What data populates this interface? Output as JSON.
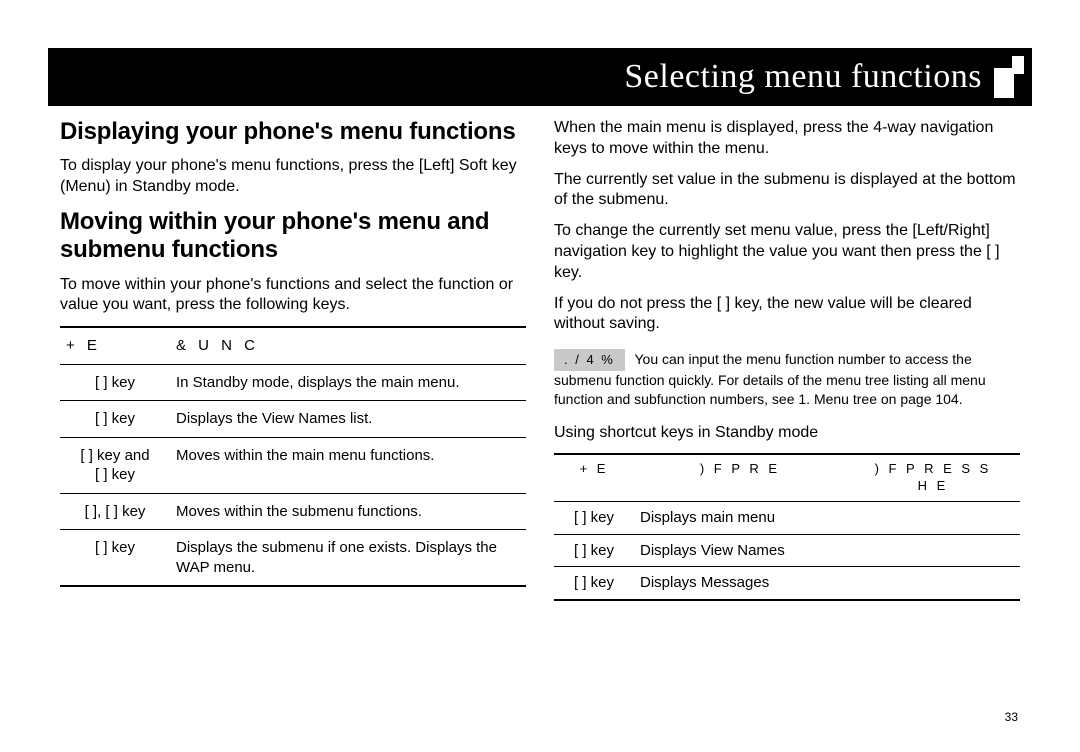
{
  "band": {
    "title": "Selecting menu functions"
  },
  "left": {
    "heading1": "Displaying your phone's menu functions",
    "para1": "To display your phone's menu functions, press the [Left] Soft key (Menu) in Standby mode.",
    "heading2": "Moving within your phone's menu and submenu functions",
    "para2": "To move within your phone's functions and select the function or value you want, press the following keys.",
    "table": {
      "headers": [
        "+ E",
        "& U N C"
      ],
      "rows": [
        {
          "key": "[     ] key",
          "func": "In Standby mode, displays the main menu."
        },
        {
          "key": "[     ] key",
          "func": "Displays the View Names list."
        },
        {
          "key": "[     ] key and\n[     ] key",
          "func": "Moves within the main menu functions."
        },
        {
          "key": "[     ], [     ] key",
          "func": "Moves within the submenu functions."
        },
        {
          "key": "[     ] key",
          "func": "Displays the submenu if one exists. Displays the WAP menu."
        }
      ]
    }
  },
  "right": {
    "para1": "When the main menu is displayed, press the 4-way navigation keys to move within the menu.",
    "para2": "The currently set value in the submenu is displayed at the bottom of the submenu.",
    "para3": "To change the currently set menu value, press the [Left/Right] navigation key to highlight the value you want then press the [      ] key.",
    "para4": "If you do not press the [      ] key, the new value will be cleared without saving.",
    "note_label": ". / 4 %",
    "note_text": "You can input the menu function number to access the submenu function quickly. For details of the menu tree listing all menu function and subfunction numbers, see 1. Menu tree on page 104.",
    "shortcut_caption": "Using shortcut keys in Standby mode",
    "table": {
      "headers": [
        "+ E",
        ") F   P R E",
        ") F   P R E S S\nH E"
      ],
      "rows": [
        {
          "key": "[     ] key",
          "pressed": "Displays main menu",
          "held": ""
        },
        {
          "key": "[     ] key",
          "pressed": "Displays View Names",
          "held": ""
        },
        {
          "key": "[     ] key",
          "pressed": "Displays Messages",
          "held": ""
        }
      ]
    }
  },
  "page_number": "33"
}
